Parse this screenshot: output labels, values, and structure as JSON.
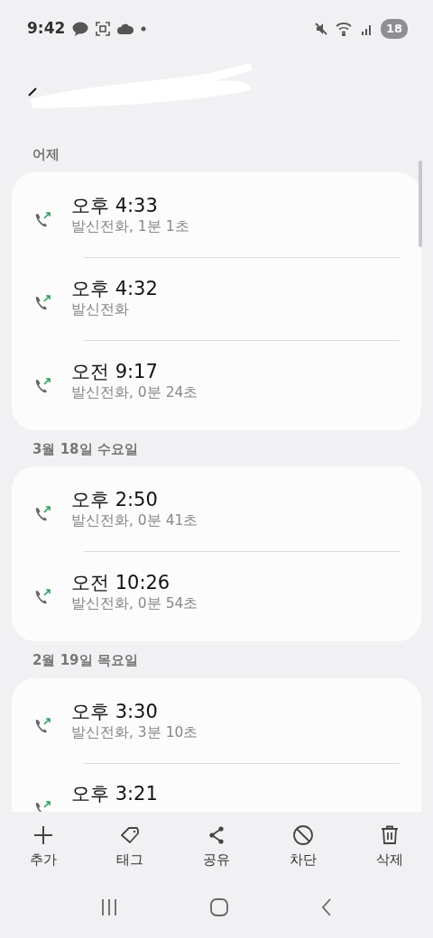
{
  "status_bar": {
    "time": "9:42",
    "battery": "18"
  },
  "sections": [
    {
      "header": "어제",
      "calls": [
        {
          "time": "오후 4:33",
          "detail": "발신전화, 1분 1초"
        },
        {
          "time": "오후 4:32",
          "detail": "발신전화"
        },
        {
          "time": "오전 9:17",
          "detail": "발신전화, 0분 24초"
        }
      ]
    },
    {
      "header": "3월 18일 수요일",
      "calls": [
        {
          "time": "오후 2:50",
          "detail": "발신전화, 0분 41초"
        },
        {
          "time": "오전 10:26",
          "detail": "발신전화, 0분 54초"
        }
      ]
    },
    {
      "header": "2월 19일 목요일",
      "calls": [
        {
          "time": "오후 3:30",
          "detail": "발신전화, 3분 10초"
        },
        {
          "time": "오후 3:21"
        }
      ]
    }
  ],
  "toolbar": [
    {
      "kind": "add",
      "label": "추가"
    },
    {
      "kind": "tag",
      "label": "태그"
    },
    {
      "kind": "share",
      "label": "공유"
    },
    {
      "kind": "block",
      "label": "차단"
    },
    {
      "kind": "delete",
      "label": "삭제"
    }
  ]
}
